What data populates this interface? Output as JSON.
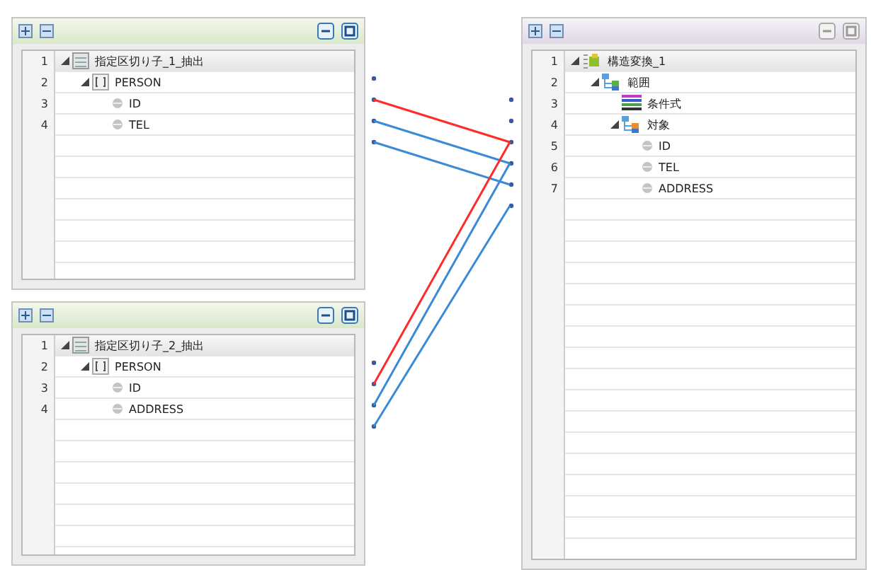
{
  "source_panels": [
    {
      "line_numbers": [
        "1",
        "2",
        "3",
        "4"
      ],
      "tree": [
        {
          "label": "指定区切り子_1_抽出",
          "kind": "source",
          "expanded": true,
          "children": [
            {
              "label": "PERSON",
              "kind": "array",
              "expanded": true,
              "children": [
                {
                  "label": "ID",
                  "kind": "field"
                },
                {
                  "label": "TEL",
                  "kind": "field"
                }
              ]
            }
          ]
        }
      ]
    },
    {
      "line_numbers": [
        "1",
        "2",
        "3",
        "4"
      ],
      "tree": [
        {
          "label": "指定区切り子_2_抽出",
          "kind": "source",
          "expanded": true,
          "children": [
            {
              "label": "PERSON",
              "kind": "array",
              "expanded": true,
              "children": [
                {
                  "label": "ID",
                  "kind": "field"
                },
                {
                  "label": "ADDRESS",
                  "kind": "field"
                }
              ]
            }
          ]
        }
      ]
    }
  ],
  "target_panel": {
    "line_numbers": [
      "1",
      "2",
      "3",
      "4",
      "5",
      "6",
      "7"
    ],
    "tree": [
      {
        "label": "構造変換_1",
        "kind": "struct",
        "expanded": true,
        "children": [
          {
            "label": "範囲",
            "kind": "group",
            "expanded": true,
            "children": [
              {
                "label": "条件式",
                "kind": "condition"
              },
              {
                "label": "対象",
                "kind": "target",
                "expanded": true,
                "children": [
                  {
                    "label": "ID",
                    "kind": "field"
                  },
                  {
                    "label": "TEL",
                    "kind": "field"
                  },
                  {
                    "label": "ADDRESS",
                    "kind": "field"
                  }
                ]
              }
            ]
          }
        ]
      }
    ]
  },
  "mappings": [
    {
      "color": "#ff2a2a"
    },
    {
      "color": "#3a8ad6"
    },
    {
      "color": "#3a8ad6"
    },
    {
      "color": "#ff2a2a"
    },
    {
      "color": "#3a8ad6"
    },
    {
      "color": "#3a8ad6"
    }
  ]
}
